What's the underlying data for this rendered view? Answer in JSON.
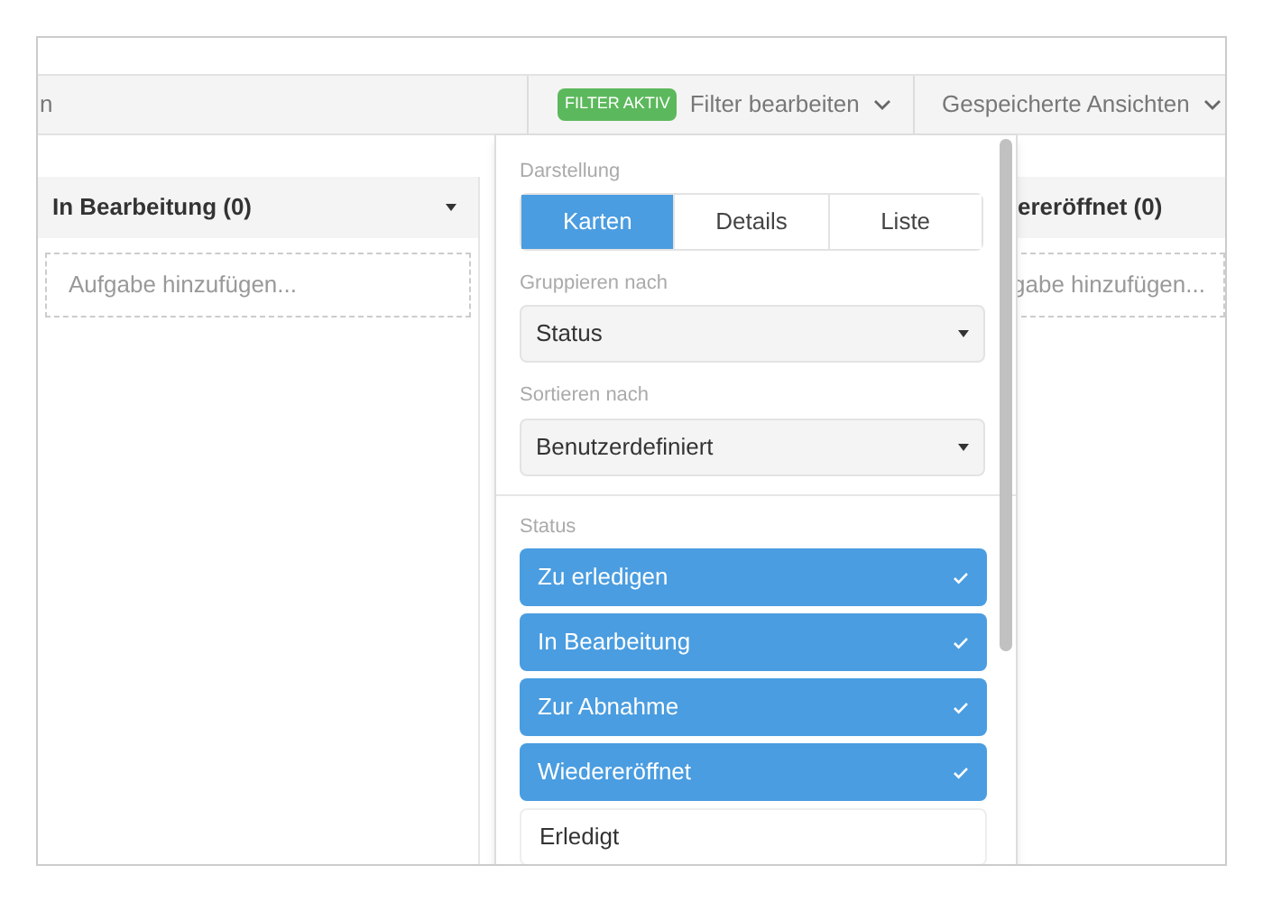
{
  "toolbar": {
    "left_text": "n",
    "filter_badge": "FILTER AKTIV",
    "filter_button": "Filter bearbeiten",
    "saved_views_button": "Gespeicherte Ansichten"
  },
  "columns": [
    {
      "title": "In Bearbeitung (0)",
      "add_placeholder": "Aufgabe hinzufügen...",
      "has_menu": true
    },
    {
      "title": "ereröffnet (0)",
      "add_placeholder": "gabe hinzufügen...",
      "has_menu": false
    }
  ],
  "popup": {
    "display_label": "Darstellung",
    "display_options": [
      {
        "label": "Karten",
        "selected": true
      },
      {
        "label": "Details",
        "selected": false
      },
      {
        "label": "Liste",
        "selected": false
      }
    ],
    "group_label": "Gruppieren nach",
    "group_value": "Status",
    "sort_label": "Sortieren nach",
    "sort_value": "Benutzerdefiniert",
    "status_label": "Status",
    "statuses": [
      {
        "label": "Zu erledigen",
        "checked": true
      },
      {
        "label": "In Bearbeitung",
        "checked": true
      },
      {
        "label": "Zur Abnahme",
        "checked": true
      },
      {
        "label": "Wiedereröffnet",
        "checked": true
      },
      {
        "label": "Erledigt",
        "checked": false
      }
    ]
  }
}
